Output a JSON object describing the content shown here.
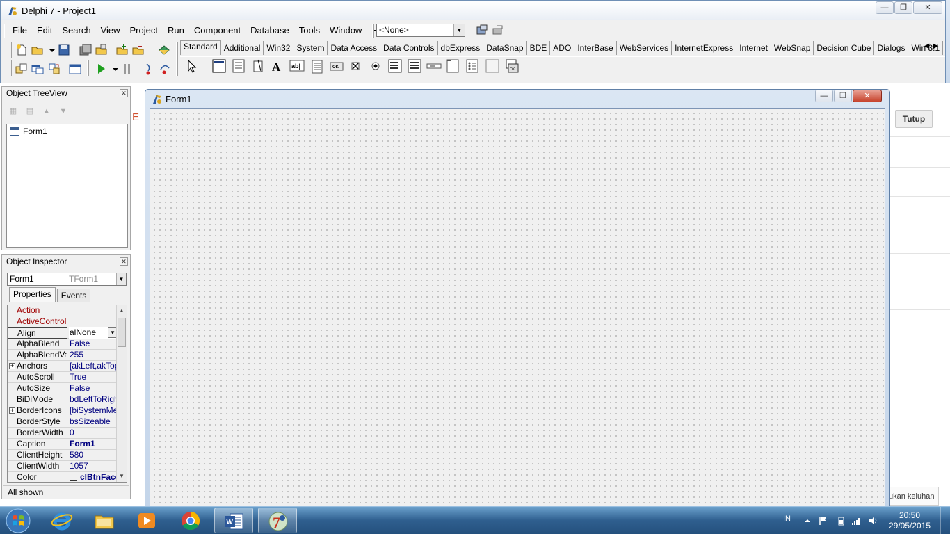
{
  "ide": {
    "title": "Delphi 7 - Project1",
    "menu": [
      "File",
      "Edit",
      "Search",
      "View",
      "Project",
      "Run",
      "Component",
      "Database",
      "Tools",
      "Window",
      "Help"
    ],
    "config_combo": "<None>"
  },
  "palette": {
    "tabs": [
      "Standard",
      "Additional",
      "Win32",
      "System",
      "Data Access",
      "Data Controls",
      "dbExpress",
      "DataSnap",
      "BDE",
      "ADO",
      "InterBase",
      "WebServices",
      "InternetExpress",
      "Internet",
      "WebSnap",
      "Decision Cube",
      "Dialogs",
      "Win 3.1"
    ],
    "active_tab": "Standard",
    "components": [
      {
        "name": "pointer",
        "glyph": "⬉"
      },
      {
        "name": "frames",
        "glyph": "▭"
      },
      {
        "name": "main-menu",
        "glyph": "☰"
      },
      {
        "name": "popup-menu",
        "glyph": "⋮"
      },
      {
        "name": "label",
        "glyph": "A"
      },
      {
        "name": "edit",
        "glyph": "ab|"
      },
      {
        "name": "memo",
        "glyph": "≣"
      },
      {
        "name": "button",
        "glyph": "OK"
      },
      {
        "name": "checkbox",
        "glyph": "☒"
      },
      {
        "name": "radio-button",
        "glyph": "◉"
      },
      {
        "name": "listbox",
        "glyph": "▤"
      },
      {
        "name": "combobox",
        "glyph": "▥"
      },
      {
        "name": "scrollbar",
        "glyph": "▭"
      },
      {
        "name": "groupbox",
        "glyph": "▢"
      },
      {
        "name": "radiogroup",
        "glyph": "☷"
      },
      {
        "name": "panel",
        "glyph": "□"
      },
      {
        "name": "action-list",
        "glyph": "▣"
      }
    ]
  },
  "treeview": {
    "title": "Object TreeView",
    "root": "Form1"
  },
  "inspector": {
    "title": "Object Inspector",
    "object_name": "Form1",
    "object_class": "TForm1",
    "tabs": [
      "Properties",
      "Events"
    ],
    "active_tab": "Properties",
    "rows": [
      {
        "name": "Action",
        "value": "",
        "style": "red"
      },
      {
        "name": "ActiveControl",
        "value": "",
        "style": "red"
      },
      {
        "name": "Align",
        "value": "alNone",
        "style": "selected"
      },
      {
        "name": "AlphaBlend",
        "value": "False",
        "style": ""
      },
      {
        "name": "AlphaBlendValue",
        "value": "255",
        "style": ""
      },
      {
        "name": "Anchors",
        "value": "[akLeft,akTop",
        "style": "expand"
      },
      {
        "name": "AutoScroll",
        "value": "True",
        "style": ""
      },
      {
        "name": "AutoSize",
        "value": "False",
        "style": ""
      },
      {
        "name": "BiDiMode",
        "value": "bdLeftToRight",
        "style": ""
      },
      {
        "name": "BorderIcons",
        "value": "[biSystemMen",
        "style": "expand"
      },
      {
        "name": "BorderStyle",
        "value": "bsSizeable",
        "style": ""
      },
      {
        "name": "BorderWidth",
        "value": "0",
        "style": ""
      },
      {
        "name": "Caption",
        "value": "Form1",
        "style": "bold"
      },
      {
        "name": "ClientHeight",
        "value": "580",
        "style": ""
      },
      {
        "name": "ClientWidth",
        "value": "1057",
        "style": ""
      },
      {
        "name": "Color",
        "value": "clBtnFace",
        "style": "color"
      }
    ],
    "status": "All shown"
  },
  "form": {
    "title": "Form1"
  },
  "background": {
    "button": "Tutup",
    "feedback": "ukan keluhan",
    "fragment": "E"
  },
  "taskbar": {
    "apps": [
      {
        "name": "internet-explorer",
        "open": false
      },
      {
        "name": "file-explorer",
        "open": false
      },
      {
        "name": "media-player",
        "open": false
      },
      {
        "name": "chrome",
        "open": false
      },
      {
        "name": "word",
        "open": true
      },
      {
        "name": "delphi",
        "open": true
      }
    ],
    "language": "IN",
    "time": "20:50",
    "date": "29/05/2015"
  },
  "colors": {
    "inspector_required": "#a00000",
    "inspector_value": "#000080",
    "taskbar": "#2f5f8f"
  }
}
